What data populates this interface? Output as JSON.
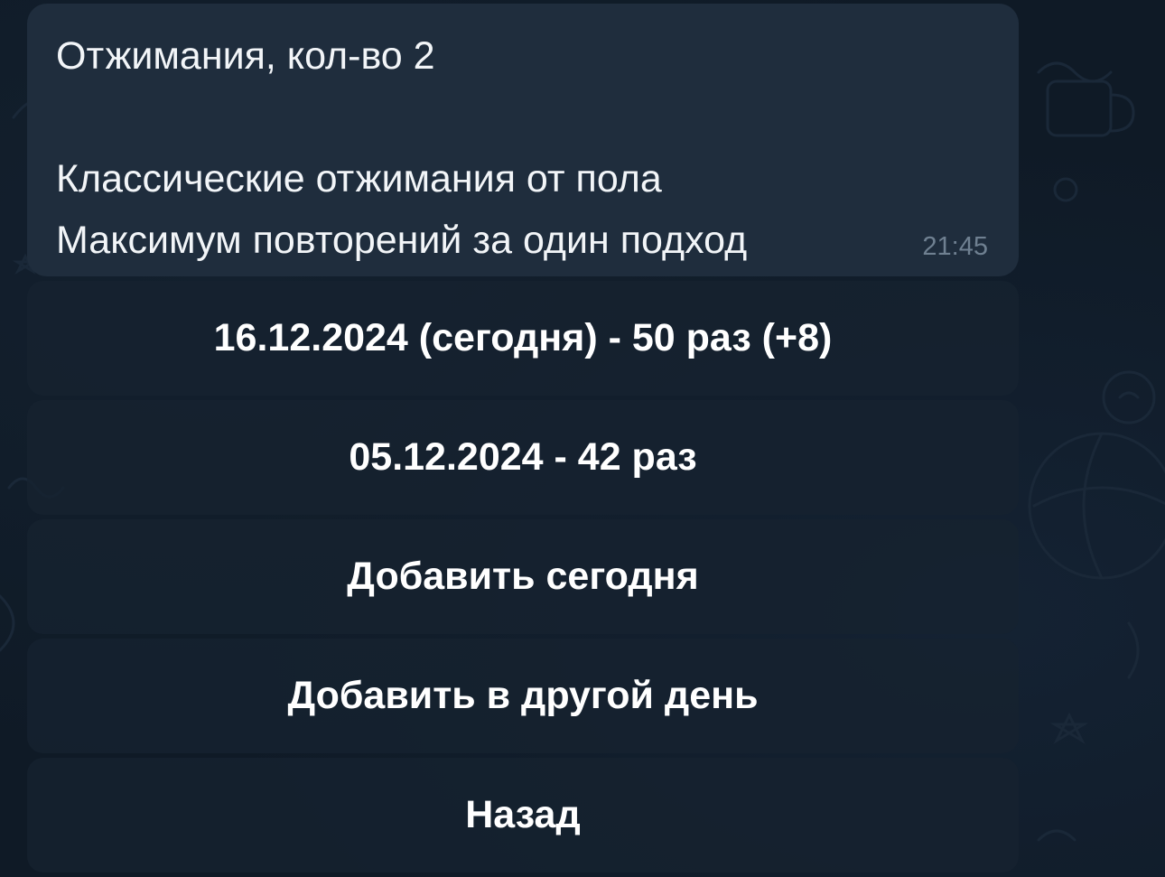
{
  "message": {
    "title": "Отжимания, кол-во 2",
    "line1": "Классические отжимания от пола",
    "line2": "Максимум повторений за один подход",
    "time": "21:45"
  },
  "keyboard": {
    "buttons": [
      {
        "label": "16.12.2024 (сегодня) - 50 раз (+8)"
      },
      {
        "label": "05.12.2024 - 42 раз"
      },
      {
        "label": "Добавить сегодня"
      },
      {
        "label": "Добавить в другой день"
      },
      {
        "label": "Назад"
      }
    ]
  },
  "colors": {
    "background": "#0f1a26",
    "bubble": "#1f2d3d",
    "button": "#162230",
    "time": "#6f8091"
  }
}
